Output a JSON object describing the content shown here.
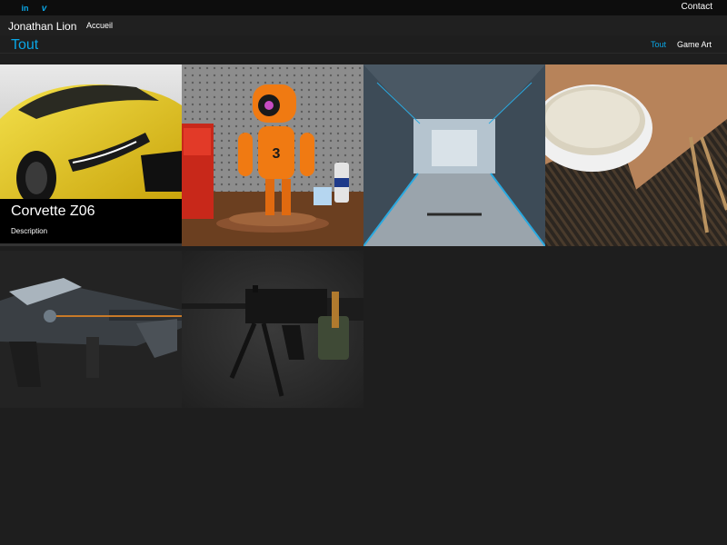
{
  "topbar": {
    "social": [
      {
        "name": "linkedin",
        "label": "in"
      },
      {
        "name": "vimeo",
        "label": "v"
      }
    ],
    "contact_label": "Contact"
  },
  "navbar": {
    "brand": "Jonathan Lion",
    "home_label": "Accueil"
  },
  "filter": {
    "title": "Tout",
    "links": [
      {
        "label": "Tout",
        "active": true
      },
      {
        "label": "Game Art",
        "active": false
      }
    ]
  },
  "gallery": [
    {
      "name": "corvette",
      "caption_title": "Corvette Z06",
      "caption_desc": "Description"
    },
    {
      "name": "robot"
    },
    {
      "name": "scifi-corridor"
    },
    {
      "name": "rice-bowl"
    },
    {
      "name": "scifi-rifle"
    },
    {
      "name": "machine-gun"
    }
  ],
  "colors": {
    "accent": "#0aa6e5",
    "topbar_bg": "#0d0d0d",
    "page_bg": "#1e1e1e"
  }
}
